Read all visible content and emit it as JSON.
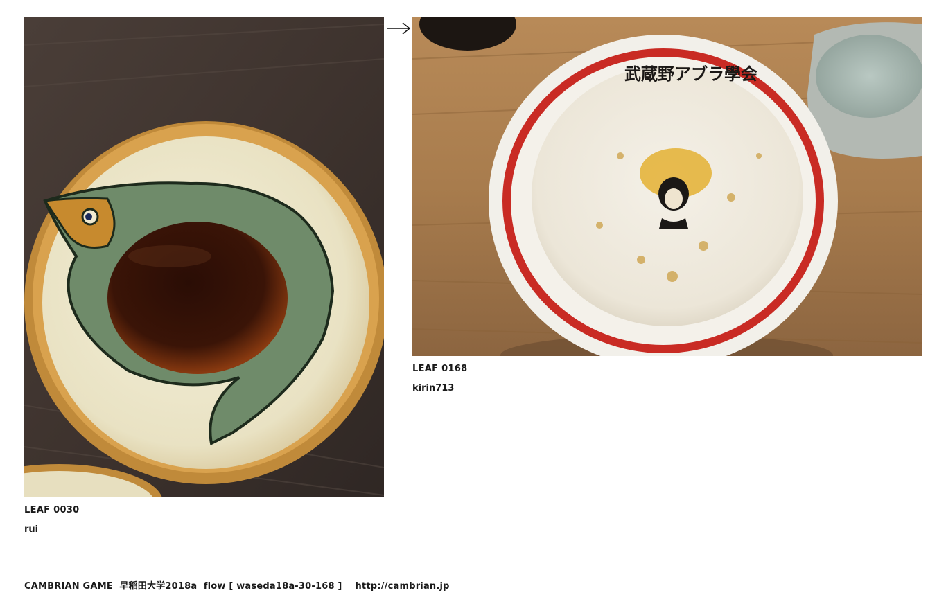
{
  "leaves": [
    {
      "id_label": "LEAF 0030",
      "author": "rui",
      "image_subject": "ceramic fish plate with soy sauce"
    },
    {
      "id_label": "LEAF 0168",
      "author": "kirin713",
      "image_subject": "empty bowl with red rim",
      "bowl_text": "武蔵野アブラ學会"
    }
  ],
  "link_icon": "right-arrow-icon",
  "footer": {
    "text": "CAMBRIAN GAME  早稲田大学2018a  flow [ waseda18a-30-168 ]    http://cambrian.jp"
  },
  "colors": {
    "text": "#1a1a1a",
    "background": "#ffffff"
  }
}
